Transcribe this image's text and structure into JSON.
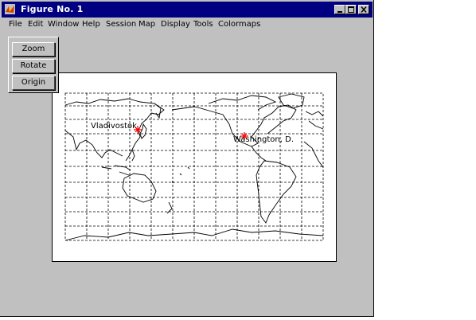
{
  "window": {
    "title": "Figure No. 1",
    "title_icon": "matlab-logo-icon",
    "controls": [
      "minimize-icon",
      "maximize-icon",
      "close-icon"
    ]
  },
  "menubar": {
    "items": [
      "File",
      "Edit",
      "Window",
      "Help",
      "Session",
      "Map",
      "Display",
      "Tools",
      "Colormaps"
    ]
  },
  "popup": {
    "buttons": [
      "Zoom",
      "Rotate",
      "Origin"
    ]
  },
  "map": {
    "labels": [
      "Vladivostok",
      "Washington, D."
    ],
    "marker_color": "#ff0000"
  },
  "colors": {
    "titlebar": "#000080",
    "window_face": "#c0c0c0",
    "highlight": "#ffffff",
    "shadow": "#000000"
  }
}
